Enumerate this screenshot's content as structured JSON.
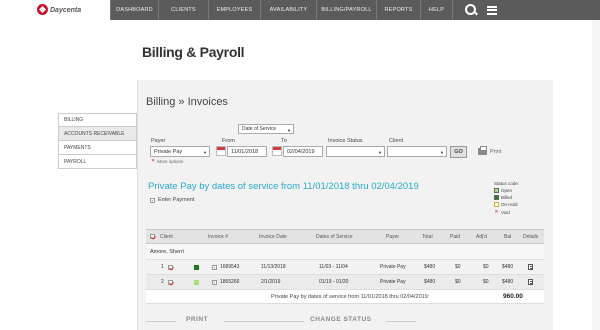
{
  "brand": {
    "name": "Daycenta"
  },
  "nav": {
    "items": [
      "DASHBOARD",
      "CLIENTS",
      "EMPLOYEES",
      "AVAILABILITY",
      "BILLING/PAYROLL",
      "REPORTS",
      "HELP"
    ],
    "icons": [
      "search-icon",
      "menu-icon"
    ]
  },
  "page": {
    "title": "Billing & Payroll",
    "subtitle": "Billing » Invoices"
  },
  "sidebar": {
    "items": [
      {
        "label": "BILLING",
        "active": false
      },
      {
        "label": "ACCOUNTS RECEIVABLE",
        "active": true
      },
      {
        "label": "PAYMENTS",
        "active": false
      },
      {
        "label": "PAYROLL",
        "active": false
      }
    ]
  },
  "filters": {
    "date_mode": "Date of Service",
    "payer_label": "Payer",
    "payer_value": "Private Pay",
    "from_label": "From",
    "from_value": "11/01/2018",
    "to_label": "To",
    "to_value": "02/04/2019",
    "invoice_status_label": "Invoice Status",
    "invoice_status_value": "",
    "client_label": "Client",
    "client_value": "",
    "go_label": "GO",
    "print_label": "Print",
    "more_options": "More options"
  },
  "results": {
    "title": "Private Pay by dates of service from 11/01/2018 thru 02/04/2019",
    "enter_payment": "Enter Payment"
  },
  "legend": {
    "title": "Status code:",
    "items": [
      {
        "label": "Open",
        "color": "#a8e07a"
      },
      {
        "label": "Billed",
        "color": "#1e7a1e"
      },
      {
        "label": "On Hold",
        "color": "#ffffff"
      },
      {
        "label": "Void",
        "color": "#cc3333"
      }
    ]
  },
  "table": {
    "columns": [
      "Client",
      "Invoice #",
      "Invoice Date",
      "Dates of Service",
      "Payer",
      "Total",
      "Paid",
      "Adj'd",
      "Bal",
      "Details"
    ],
    "group": "Amore, Sherri",
    "rows": [
      {
        "num": "1",
        "status_color": "#1e7a1e",
        "invoice": "1689543",
        "invoice_date": "11/13/2018",
        "dates": "11/03 - 11/04",
        "payer": "Private Pay",
        "total": "$480",
        "paid": "$0",
        "adj": "$0",
        "bal": "$480"
      },
      {
        "num": "2",
        "status_color": "#a8e07a",
        "invoice": "1865266",
        "invoice_date": "2/1/2019",
        "dates": "01/19 - 01/20",
        "payer": "Private Pay",
        "total": "$480",
        "paid": "$0",
        "adj": "$0",
        "bal": "$480"
      }
    ],
    "total_label": "Private Pay by dates of service from 11/01/2018 thru 02/04/2019:",
    "total_value": "960.00"
  },
  "bottom": {
    "print_label": "PRINT",
    "change_status_label": "CHANGE STATUS"
  }
}
